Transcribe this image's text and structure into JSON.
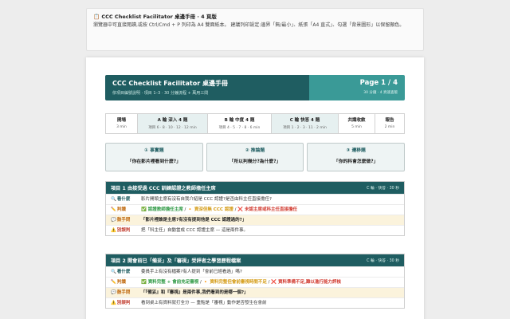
{
  "notice": {
    "title": "📋 CCC Checklist Facilitator 桌邊手冊 · 4 頁版",
    "body": "瀏覽器中可直接閱讀,或按 Ctrl/Cmd + P 列印為 A4 雙面紙本。 建議列印設定:邊界「無/最小」、紙張「A4 直式」、勾選「背景圖形」以保留顏色。"
  },
  "header": {
    "title": "CCC Checklist Facilitator 桌邊手冊",
    "subtitle": "依項目編號說明 · 項目 1–3 · 30 分鐘流程 + 萬用三問",
    "page": "Page 1 / 4",
    "meta": "30 分鐘 · 4 頁速查版"
  },
  "flow": [
    {
      "name": "開場",
      "time": "3 min"
    },
    {
      "name": "A 輪 深入 4 題",
      "time": "項目 6 · 8 · 10 · 12 · 12 min"
    },
    {
      "name": "B 輪 中度 4 題",
      "time": "項目 4 · 5 · 7 · 8 · 6 min"
    },
    {
      "name": "C 輪 快答 4 題",
      "time": "項目 1 · 2 · 3 · 11 · 2 min"
    },
    {
      "name": "共識收斂",
      "time": "5 min"
    },
    {
      "name": "報告",
      "time": "2 min"
    }
  ],
  "questions": [
    {
      "title": "① 事實題",
      "text": "「你在影片裡看到什麼?」"
    },
    {
      "title": "② 推論題",
      "text": "「所以判幾分?為什麼?」"
    },
    {
      "title": "③ 遷移題",
      "text": "「你的科會怎麼做?」"
    }
  ],
  "items": [
    {
      "title": "項目 1 由接受過 CCC 訓練認證之教師擔任主席",
      "tag": "C 輪 · 快答 · 30 秒",
      "rows": [
        {
          "icon": "🔍",
          "label": "看什麼",
          "value": "影片開頭主席有沒有自我介紹是 CCC 認證?是否由科主任直接擔任?"
        },
        {
          "icon": "✏️",
          "label": "判讀",
          "ok": "✅ 認證教師擔任主席",
          "mid": "🔸 資深但無 CCC 認證",
          "bad": "❌ 未認主席或科主任直接擔任"
        },
        {
          "icon": "💬",
          "label": "鼓手問",
          "value": "「影片裡誰是主席?有沒有提到他是 CCC 認證過的?」"
        },
        {
          "icon": "⚠️",
          "label": "別誤判",
          "value": "把「科主任」自動當成 CCC 認證主席 — 這是兩件事。"
        }
      ]
    },
    {
      "title": "項目 2 開會前已「備妥」及「審視」受評者之學習歷程檔案",
      "tag": "C 輪 · 快答 · 30 秒",
      "rows": [
        {
          "icon": "🔍",
          "label": "看什麼",
          "value": "委員手上有沒有檔案?有人提到「會前已經看過」嗎?"
        },
        {
          "icon": "✏️",
          "label": "判讀",
          "ok": "✅ 資料完整 + 會前充足審視",
          "mid": "🔸 資料完整但會前審視時間不足",
          "bad": "❌ 資料準備不足,難以進行能力評核"
        },
        {
          "icon": "💬",
          "label": "鼓手問",
          "value": "「『備妥』和『審視』是兩件事,我們看到的是哪一個?」"
        },
        {
          "icon": "⚠️",
          "label": "別誤判",
          "value": "看到桌上有資料就打全分 — 重點是「審視」動作是否發生在會前"
        }
      ]
    }
  ]
}
